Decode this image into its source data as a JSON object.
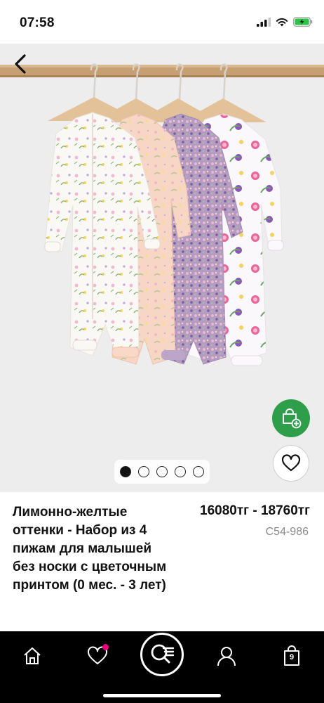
{
  "status_bar": {
    "time": "07:58"
  },
  "gallery": {
    "page_count": 5,
    "active_page": 1
  },
  "product": {
    "title": "Лимонно-желтые оттенки - Набор из 4 пижам для малышей без носки с цветочным принтом (0 мес. - 3 лет)",
    "price": "16080тг - 18760тг",
    "code": "C54-986"
  },
  "bottom_nav": {
    "items": [
      {
        "icon": "home-icon"
      },
      {
        "icon": "heart-icon",
        "has_badge": true
      },
      {
        "icon": "search-icon"
      },
      {
        "icon": "profile-icon"
      },
      {
        "icon": "bag-icon",
        "count": "9"
      }
    ]
  },
  "colors": {
    "accent_green": "#2f9e4a",
    "badge_pink": "#e6007e",
    "nav_bg": "#000000"
  }
}
